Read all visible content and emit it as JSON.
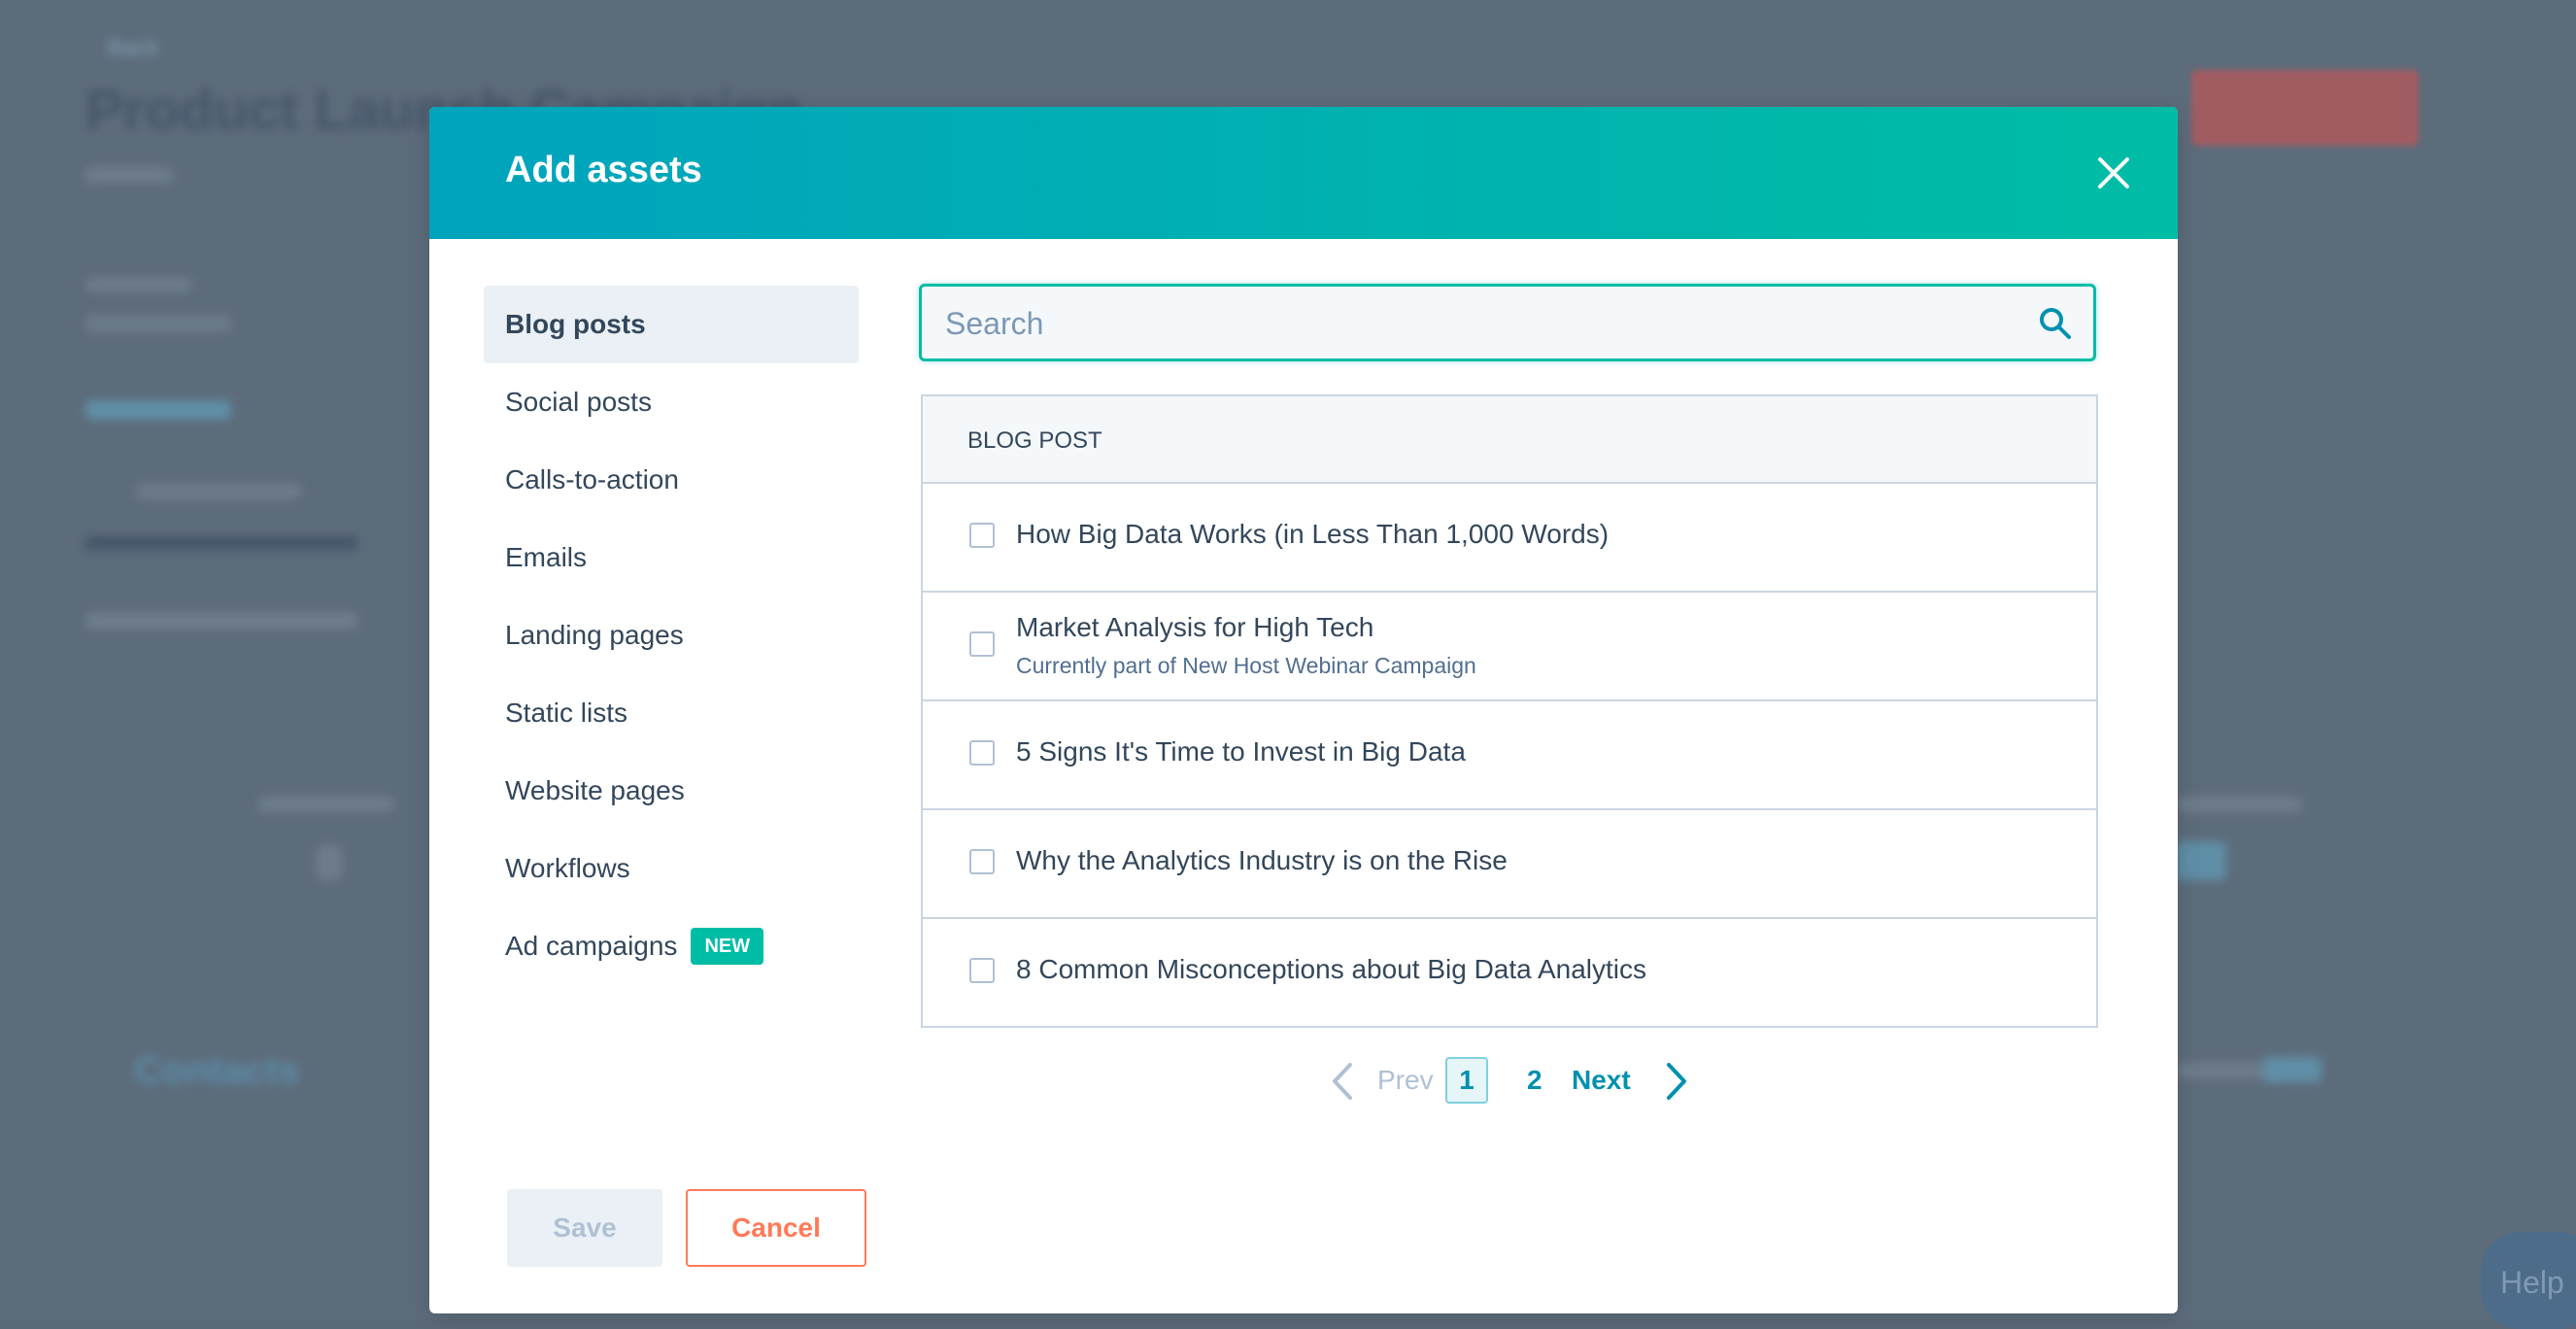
{
  "background": {
    "back_link": "Back",
    "page_title": "Product Launch Campaign",
    "section_title": "Contacts",
    "help_label": "Help"
  },
  "modal": {
    "title": "Add assets",
    "close_icon": "close-icon",
    "sidebar": {
      "items": [
        {
          "label": "Blog posts",
          "active": true
        },
        {
          "label": "Social posts"
        },
        {
          "label": "Calls-to-action"
        },
        {
          "label": "Emails"
        },
        {
          "label": "Landing pages"
        },
        {
          "label": "Static lists"
        },
        {
          "label": "Website pages"
        },
        {
          "label": "Workflows"
        },
        {
          "label": "Ad campaigns",
          "badge": "NEW"
        }
      ]
    },
    "search": {
      "placeholder": "Search",
      "value": "",
      "icon": "search-icon"
    },
    "table": {
      "header": "BLOG POST",
      "rows": [
        {
          "title": "How Big Data Works (in Less Than 1,000 Words)",
          "subtitle": ""
        },
        {
          "title": "Market Analysis for High Tech",
          "subtitle": "Currently part of New Host Webinar Campaign"
        },
        {
          "title": "5 Signs It's Time to Invest in Big Data",
          "subtitle": ""
        },
        {
          "title": "Why the Analytics Industry is on the Rise",
          "subtitle": ""
        },
        {
          "title": "8 Common Misconceptions about Big Data Analytics",
          "subtitle": ""
        }
      ]
    },
    "pagination": {
      "prev": "Prev",
      "pages": [
        "1",
        "2"
      ],
      "current": "1",
      "next": "Next"
    },
    "footer": {
      "save": "Save",
      "cancel": "Cancel"
    }
  },
  "colors": {
    "header_gradient_start": "#00a4bd",
    "header_gradient_end": "#00bda5",
    "badge": "#00bda5",
    "cancel": "#ff7a59",
    "link": "#0091ae",
    "overlay": "#5d6c7b"
  }
}
